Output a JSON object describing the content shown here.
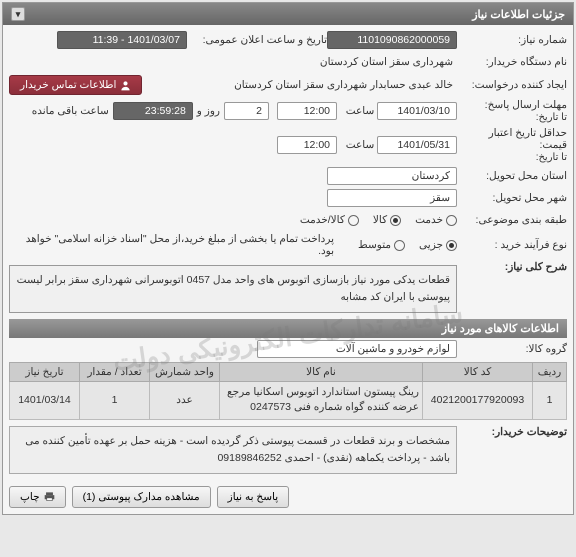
{
  "panel": {
    "title": "جزئیات اطلاعات نیاز"
  },
  "fields": {
    "need_no_label": "شماره نیاز:",
    "need_no": "1101090862000059",
    "announce_label": "تاریخ و ساعت اعلان عمومی:",
    "announce": "1401/03/07 - 11:39",
    "org_label": "نام دستگاه خریدار:",
    "org": "شهرداری سقز استان کردستان",
    "requester_label": "ایجاد کننده درخواست:",
    "requester": "خالد عبدی حسابدار شهرداری سقز استان کردستان",
    "contact_btn": "اطلاعات تماس خریدار",
    "deadline_label": "مهلت ارسال پاسخ:",
    "deadline_to": "تا تاریخ:",
    "deadline_date": "1401/03/10",
    "time_label": "ساعت",
    "deadline_time": "12:00",
    "remain_days": "2",
    "remain_days_label": "روز و",
    "remain_time": "23:59:28",
    "remain_suffix": "ساعت باقی مانده",
    "validity_label": "حداقل تاریخ اعتبار قیمت:",
    "validity_to": "تا تاریخ:",
    "validity_date": "1401/05/31",
    "validity_time": "12:00",
    "province_label": "استان محل تحویل:",
    "province": "کردستان",
    "city_label": "شهر محل تحویل:",
    "city": "سقز",
    "category_label": "طبقه بندی موضوعی:",
    "cat_service": "خدمت",
    "cat_goods": "کالا",
    "cat_goods_service": "کالا/خدمت",
    "process_label": "نوع فرآیند خرید :",
    "proc_partial": "جزیی",
    "proc_medium": "متوسط",
    "proc_note": "پرداخت تمام یا بخشی از مبلغ خرید،از محل \"اسناد خزانه اسلامی\" خواهد بود.",
    "main_desc_label": "شرح کلی نیاز:",
    "main_desc": "قطعات یدکی مورد نیاز بازسازی اتوبوس های واحد مدل 0457 اتوبوسرانی شهرداری سقز برابر لیست پیوستی با ایران کد مشابه"
  },
  "goods": {
    "header": "اطلاعات کالاهای مورد نیاز",
    "group_label": "گروه کالا:",
    "group": "لوازم خودرو و ماشین آلات",
    "table": {
      "headers": [
        "ردیف",
        "کد کالا",
        "نام کالا",
        "واحد شمارش",
        "تعداد / مقدار",
        "تاریخ نیاز"
      ],
      "row": {
        "idx": "1",
        "code": "4021200177920093",
        "name": "رینگ پیستون استاندارد اتوبوس اسکانیا مرجع عرضه کننده گواه شماره فنی 0247573",
        "unit": "عدد",
        "qty": "1",
        "date": "1401/03/14"
      }
    },
    "notes_label": "توضیحات خریدار:",
    "notes": "مشخصات و برند قطعات در قسمت پیوستی ذکر گردیده است - هزینه حمل بر عهده تأمین کننده می باشد - پرداخت یکماهه (نقدی) - احمدی 09189846252"
  },
  "footer": {
    "respond": "پاسخ به نیاز",
    "attachments": "مشاهده مدارک پیوستی (1)",
    "print": "چاپ"
  },
  "watermark": "سامانه تدارکات الکترونیکی دولت"
}
